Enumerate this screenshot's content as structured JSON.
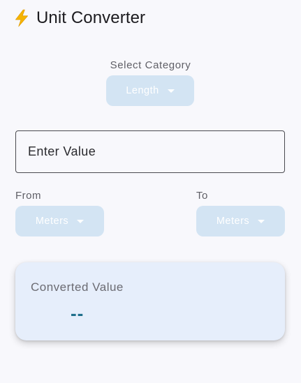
{
  "header": {
    "icon": "lightning-bolt-icon",
    "title": "Unit Converter"
  },
  "category": {
    "label": "Select Category",
    "selected": "Length"
  },
  "input": {
    "placeholder": "Enter Value",
    "value": ""
  },
  "from": {
    "label": "From",
    "selected": "Meters"
  },
  "to": {
    "label": "To",
    "selected": "Meters"
  },
  "result": {
    "label": "Converted Value",
    "value": "--"
  },
  "colors": {
    "background": "#f8f8fc",
    "dropdown_bg": "#d3e4f3",
    "card_bg": "#e6eefb",
    "result_text": "#1f6f8b",
    "bolt": "#f5b400"
  }
}
